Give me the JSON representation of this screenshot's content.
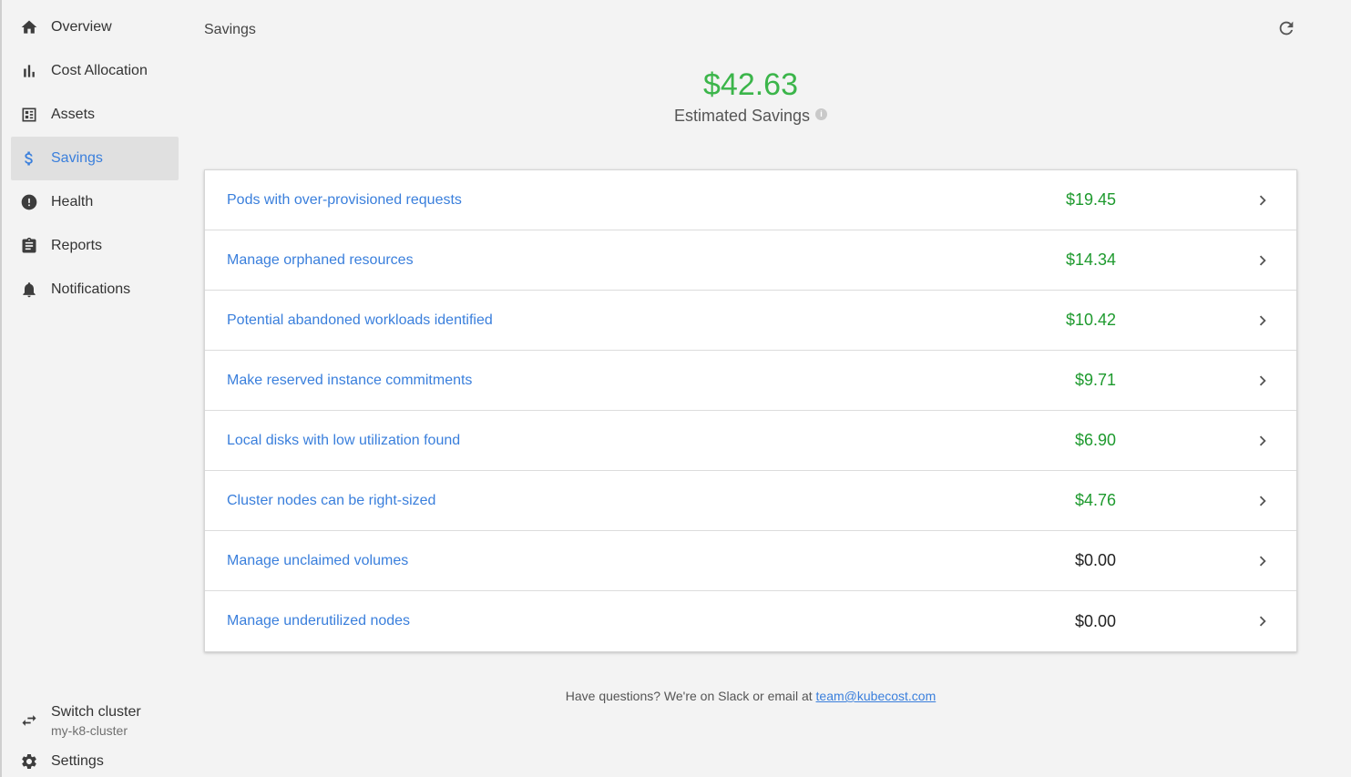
{
  "sidebar": {
    "items": [
      {
        "label": "Overview",
        "icon": "home-icon"
      },
      {
        "label": "Cost Allocation",
        "icon": "bar-chart-icon"
      },
      {
        "label": "Assets",
        "icon": "assets-icon"
      },
      {
        "label": "Savings",
        "icon": "dollar-icon",
        "active": true
      },
      {
        "label": "Health",
        "icon": "alert-icon"
      },
      {
        "label": "Reports",
        "icon": "clipboard-icon"
      },
      {
        "label": "Notifications",
        "icon": "bell-icon"
      }
    ],
    "cluster": {
      "title": "Switch cluster",
      "name": "my-k8-cluster",
      "icon": "swap-icon"
    },
    "settings": {
      "label": "Settings",
      "icon": "gear-icon"
    }
  },
  "header": {
    "title": "Savings",
    "refresh_icon": "refresh-icon"
  },
  "summary": {
    "amount": "$42.63",
    "caption": "Estimated Savings",
    "info_icon": "info-icon"
  },
  "savings": [
    {
      "label": "Pods with over-provisioned requests",
      "value": "$19.45",
      "color": "#1e9a2e"
    },
    {
      "label": "Manage orphaned resources",
      "value": "$14.34",
      "color": "#1e9a2e"
    },
    {
      "label": "Potential abandoned workloads identified",
      "value": "$10.42",
      "color": "#1e9a2e"
    },
    {
      "label": "Make reserved instance commitments",
      "value": "$9.71",
      "color": "#1e9a2e"
    },
    {
      "label": "Local disks with low utilization found",
      "value": "$6.90",
      "color": "#1e9a2e"
    },
    {
      "label": "Cluster nodes can be right-sized",
      "value": "$4.76",
      "color": "#1e9a2e"
    },
    {
      "label": "Manage unclaimed volumes",
      "value": "$0.00",
      "color": "#222222"
    },
    {
      "label": "Manage underutilized nodes",
      "value": "$0.00",
      "color": "#222222"
    }
  ],
  "footer": {
    "text": "Have questions? We're on Slack or email at ",
    "email": "team@kubecost.com"
  },
  "colors": {
    "accent": "#3a7fdc",
    "summary_green": "#3bb54a",
    "value_green": "#1e9a2e"
  }
}
